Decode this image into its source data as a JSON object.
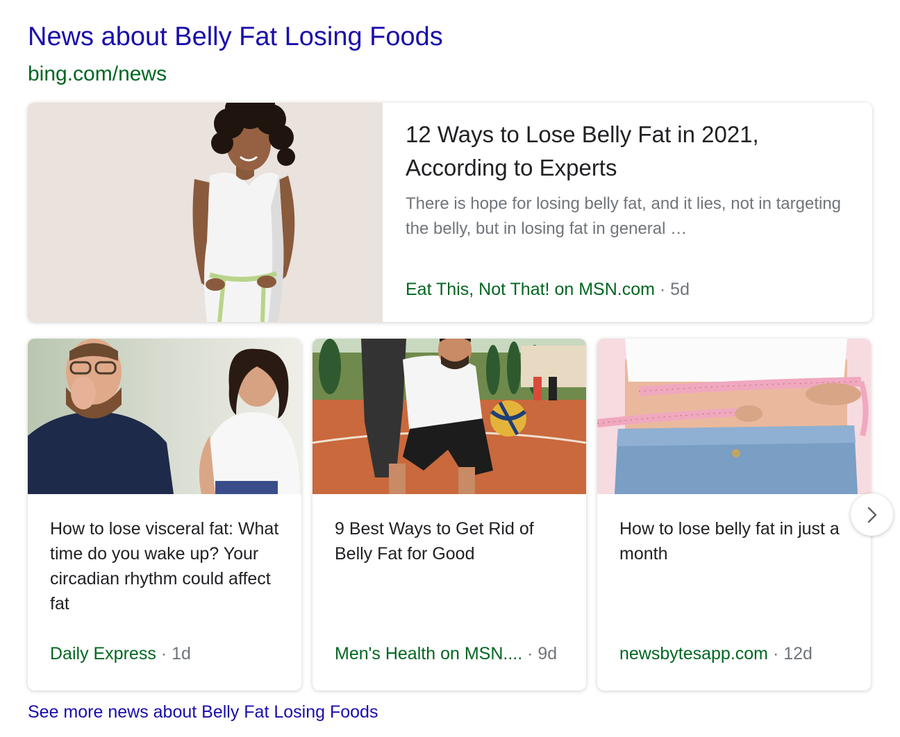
{
  "header": {
    "title": "News about Belly Fat Losing Foods",
    "source": "bing.com/news"
  },
  "featured": {
    "headline": "12 Ways to Lose Belly Fat in 2021, According to Experts",
    "snippet": "There is hope for losing belly fat, and it lies, not in targeting the belly, but in losing fat in general …",
    "source": "Eat This, Not That! on MSN.com",
    "separator": "·",
    "age": "5d"
  },
  "cards": [
    {
      "headline": "How to lose visceral fat: What time do you wake up? Your circadian rhythm could affect fat",
      "source": "Daily Express",
      "separator": "·",
      "age": "1d"
    },
    {
      "headline": "9 Best Ways to Get Rid of Belly Fat for Good",
      "source": "Men's Health on MSN....",
      "separator": "·",
      "age": "9d"
    },
    {
      "headline": "How to lose belly fat in just a month",
      "source": "newsbytesapp.com",
      "separator": "·",
      "age": "12d"
    }
  ],
  "next_button_icon": "chevron-right-icon",
  "see_more": "See more news about Belly Fat Losing Foods",
  "colors": {
    "link": "#1a0dab",
    "source_green": "#006621",
    "meta_gray": "#70757a",
    "headline": "#202124"
  }
}
